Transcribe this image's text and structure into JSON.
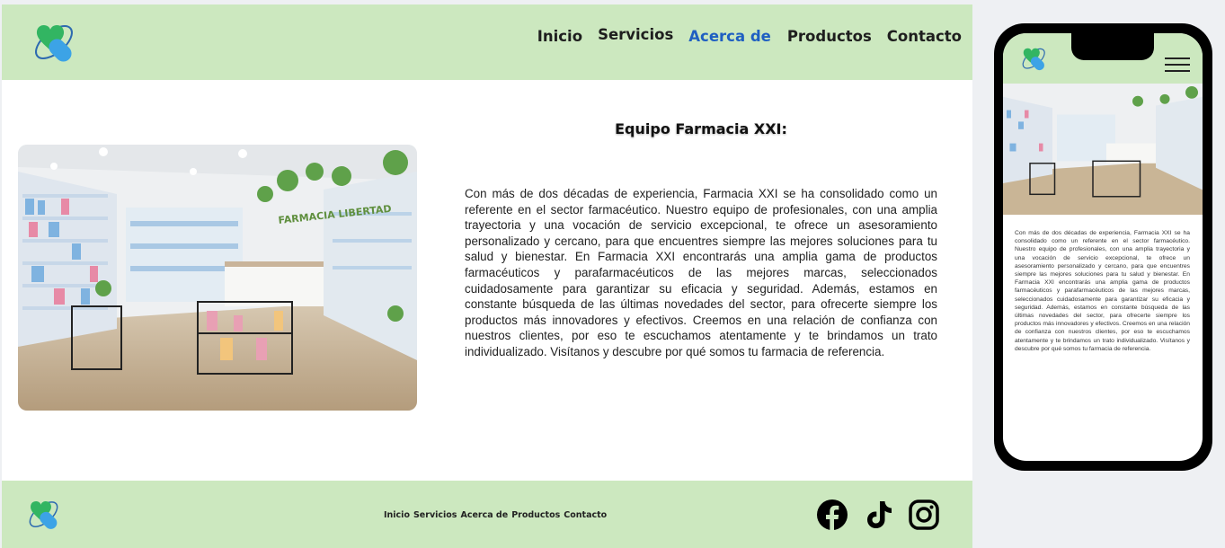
{
  "header": {
    "logo_icon": "heart-pill-logo-icon",
    "nav": [
      {
        "label": "Inicio",
        "active": false
      },
      {
        "label": "Servicios",
        "active": false
      },
      {
        "label": "Acerca de",
        "active": true
      },
      {
        "label": "Productos",
        "active": false
      },
      {
        "label": "Contacto",
        "active": false
      }
    ]
  },
  "main": {
    "title": "Equipo Farmacia XXI:",
    "image_alt": "pharmacy-interior-photo",
    "image_sign": "FARMACIA LIBERTAD",
    "paragraph": "Con más de dos décadas de experiencia, Farmacia XXI se ha consolidado como un referente en el sector farmacéutico. Nuestro equipo de profesionales, con una amplia trayectoria y una vocación de servicio excepcional, te ofrece un asesoramiento personalizado y cercano, para que encuentres siempre las mejores soluciones para tu salud y bienestar. En Farmacia XXI encontrarás una amplia gama de productos farmacéuticos y parafarmacéuticos de las mejores marcas, seleccionados cuidadosamente para garantizar su eficacia y seguridad. Además, estamos en constante búsqueda de las últimas novedades del sector, para ofrecerte siempre los productos más innovadores y efectivos. Creemos en una relación de confianza con nuestros clientes, por eso te escuchamos atentamente y te brindamos un trato individualizado. Visítanos y descubre por qué somos tu farmacia de referencia."
  },
  "footer": {
    "nav": [
      "Inicio",
      "Servicios",
      "Acerca de",
      "Productos",
      "Contacto"
    ],
    "social_icons": [
      "facebook-icon",
      "tiktok-icon",
      "instagram-icon"
    ]
  },
  "mobile": {
    "menu_icon": "hamburger-menu-icon"
  },
  "colors": {
    "header_bg": "#cce8bf",
    "nav_active": "#1f5fc2",
    "logo_green": "#2fae5e",
    "logo_blue": "#3aa0e0"
  }
}
